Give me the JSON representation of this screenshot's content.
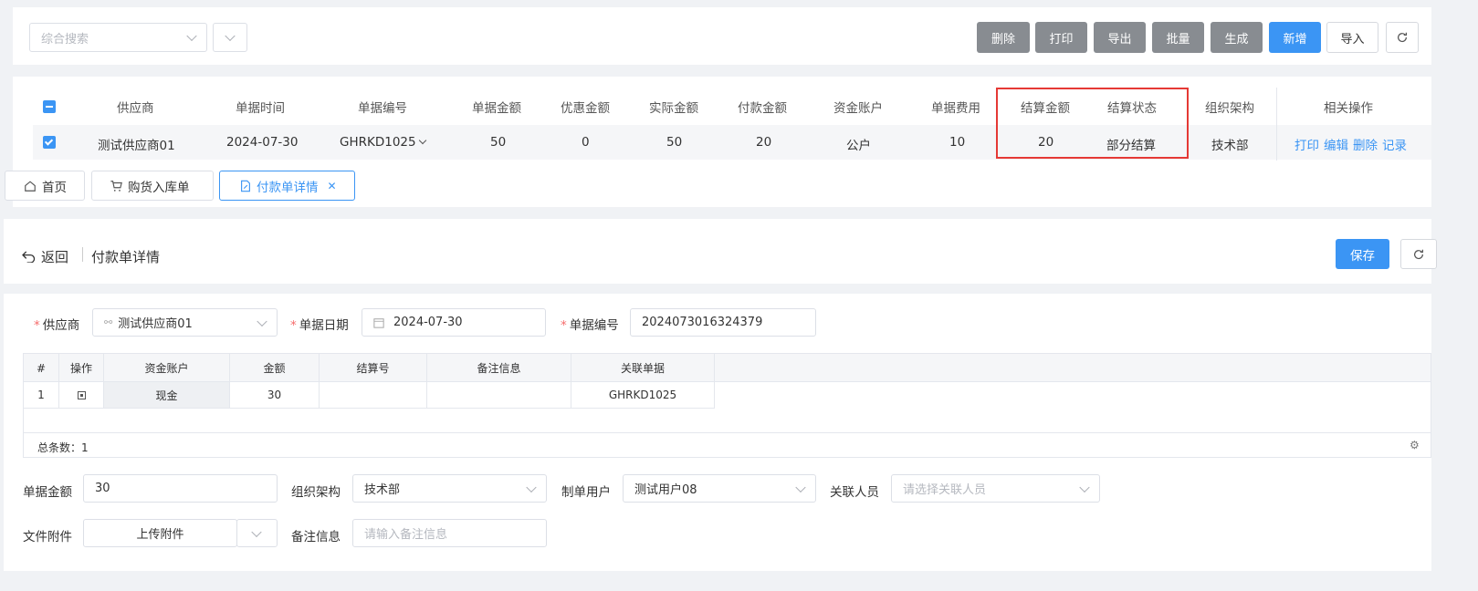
{
  "toolbar": {
    "search_placeholder": "综合搜索",
    "buttons": {
      "delete": "删除",
      "print": "打印",
      "export": "导出",
      "batch": "批量",
      "generate": "生成",
      "add": "新增",
      "import": "导入"
    }
  },
  "list_table": {
    "headers": [
      "供应商",
      "单据时间",
      "单据编号",
      "单据金额",
      "优惠金额",
      "实际金额",
      "付款金额",
      "资金账户",
      "单据费用",
      "结算金额",
      "结算状态",
      "组织架构",
      "相关操作"
    ],
    "row": {
      "supplier": "测试供应商01",
      "time": "2024-07-30",
      "number": "GHRKD1025",
      "amount": "50",
      "discount": "0",
      "actual": "50",
      "payment": "20",
      "account": "公户",
      "fee": "10",
      "settle_amount": "20",
      "settle_status": "部分结算",
      "org": "技术部",
      "actions": [
        "打印",
        "编辑",
        "删除",
        "记录"
      ]
    }
  },
  "tabs": [
    {
      "label": "首页",
      "icon": "home-icon"
    },
    {
      "label": "购货入库单",
      "icon": "cart-icon"
    },
    {
      "label": "付款单详情",
      "icon": "edit-document-icon",
      "active": true
    }
  ],
  "detail_header": {
    "back_label": "返回",
    "title": "付款单详情",
    "save_label": "保存"
  },
  "form": {
    "supplier_label": "供应商",
    "supplier_value": "测试供应商01",
    "date_label": "单据日期",
    "date_value": "2024-07-30",
    "number_label": "单据编号",
    "number_value": "2024073016324379"
  },
  "grid": {
    "headers": [
      "#",
      "操作",
      "资金账户",
      "金额",
      "结算号",
      "备注信息",
      "关联单据"
    ],
    "row": {
      "index": "1",
      "account": "现金",
      "amount": "30",
      "settle_no": "",
      "remark": "",
      "related": "GHRKD1025"
    },
    "total_label": "总条数：1"
  },
  "footer_form": {
    "amount_label": "单据金额",
    "amount_value": "30",
    "org_label": "组织架构",
    "org_value": "技术部",
    "creator_label": "制单用户",
    "creator_value": "测试用户08",
    "related_person_label": "关联人员",
    "related_person_placeholder": "请选择关联人员",
    "attachment_label": "文件附件",
    "upload_label": "上传附件",
    "remark_label": "备注信息",
    "remark_placeholder": "请输入备注信息"
  },
  "colors": {
    "primary": "#3b95f4",
    "gray_button": "#888c91",
    "highlight_border": "#e53935",
    "required": "#f56c6c"
  }
}
